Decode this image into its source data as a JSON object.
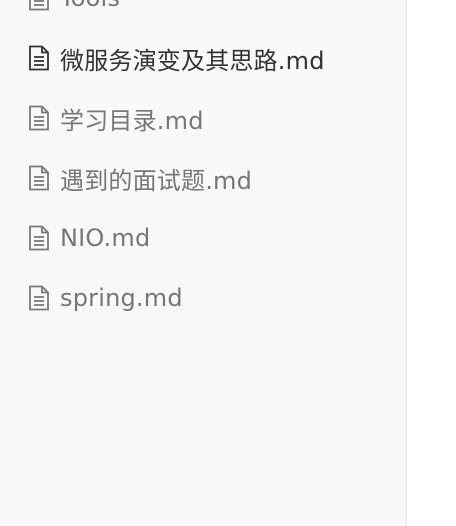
{
  "sidebar": {
    "files": [
      {
        "name": "Tools",
        "icon": "document-icon",
        "active": false
      },
      {
        "name": "微服务演变及其思路.md",
        "icon": "document-icon",
        "active": true
      },
      {
        "name": "学习目录.md",
        "icon": "document-icon",
        "active": false
      },
      {
        "name": "遇到的面试题.md",
        "icon": "document-icon",
        "active": false
      },
      {
        "name": "NIO.md",
        "icon": "document-icon",
        "active": false
      },
      {
        "name": "spring.md",
        "icon": "document-icon",
        "active": false
      }
    ]
  },
  "colors": {
    "sidebar_bg": "#f9f9f9",
    "text_active": "#333333",
    "text_inactive": "#777777",
    "border": "#e2e2e2"
  }
}
